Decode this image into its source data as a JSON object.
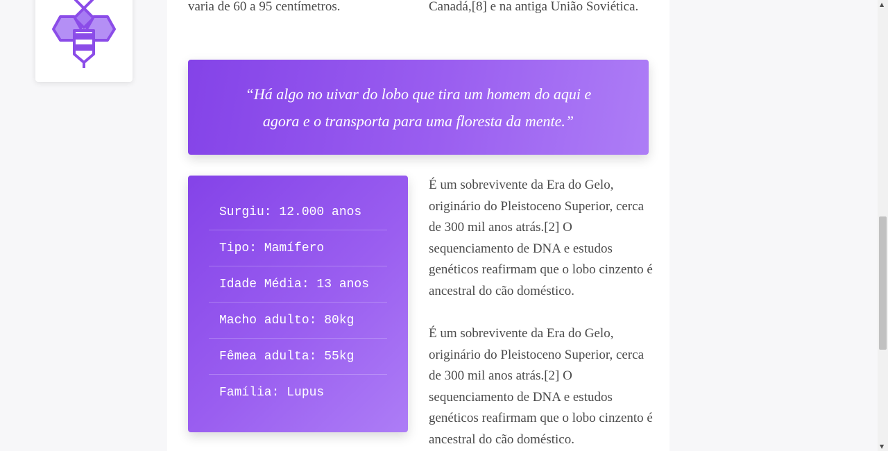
{
  "logo": {
    "icon": "bee-icon",
    "color": "#8b4ce8"
  },
  "top": {
    "left_text": "varia de 60 a 95 centímetros.",
    "right_text": "Canadá,[8] e na antiga União Soviética."
  },
  "quote": {
    "text": "“Há algo no uivar do lobo que tira um homem do aqui e agora e o transporta para uma floresta da mente.”"
  },
  "facts": {
    "items": [
      "Surgiu: 12.000 anos",
      "Tipo: Mamífero",
      "Idade Média: 13 anos",
      "Macho adulto: 80kg",
      "Fêmea adulta: 55kg",
      "Família: Lupus"
    ]
  },
  "paragraphs": [
    "É um sobrevivente da Era do Gelo, originário do Pleistoceno Superior, cerca de 300 mil anos atrás.[2] O sequenciamento de DNA e estudos genéticos reafirmam que o lobo cinzento é ancestral do cão doméstico.",
    "É um sobrevivente da Era do Gelo, originário do Pleistoceno Superior, cerca de 300 mil anos atrás.[2] O sequenciamento de DNA e estudos genéticos reafirmam que o lobo cinzento é ancestral do cão doméstico."
  ],
  "colors": {
    "accent": "#8443e8",
    "accent_light": "#ad7df6",
    "text": "#4a4a4a"
  },
  "scrollbar": {
    "up_icon": "scroll-up-arrow-icon",
    "down_icon": "scroll-down-arrow-icon"
  }
}
